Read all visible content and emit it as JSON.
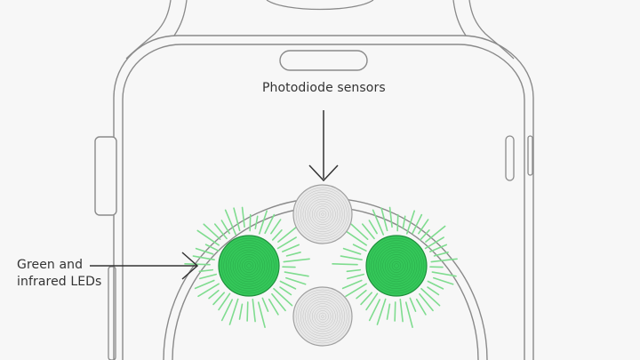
{
  "labels": {
    "photodiode": "Photodiode sensors",
    "leds_line1": "Green and",
    "leds_line2": "infrared LEDs"
  },
  "colors": {
    "background": "#f7f7f7",
    "outline": "#8a8a8a",
    "led_fill": "#34c759",
    "led_ring": "#1f8f3c",
    "ray": "#7fdc8f",
    "sensor_fill": "#e8e8e8",
    "sensor_ring": "#a0a0a0",
    "text": "#333333",
    "arrow": "#333333"
  },
  "icons": {
    "watch": "watch-back-outline",
    "crown": "digital-crown-icon",
    "sensor": "photodiode-sensor-icon",
    "led": "green-led-icon"
  }
}
